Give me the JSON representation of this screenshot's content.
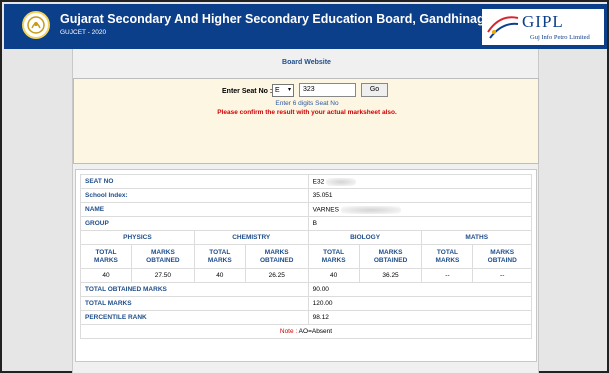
{
  "header": {
    "title": "Gujarat Secondary And Higher Secondary Education Board, Gandhinagar",
    "subtitle": "GUJCET - 2020",
    "brand_name": "GIPL",
    "brand_tagline": "Guj Info Petro Limited",
    "brand_color": "#0c3f8a"
  },
  "board_link": "Board Website",
  "seat_form": {
    "label": "Enter Seat No :",
    "select_value": "E",
    "input_value": "323",
    "go_label": "Go",
    "hint": "Enter 6 digits Seat No",
    "warning": "Please confirm the result with your actual marksheet also."
  },
  "student": {
    "seat_no_label": "SEAT NO",
    "seat_no_value": "E32",
    "school_index_label": "School Index:",
    "school_index_value": "35.051",
    "name_label": "NAME",
    "name_value": "VARNES",
    "group_label": "GROUP",
    "group_value": "B"
  },
  "subjects": [
    {
      "name": "PHYSICS",
      "total_label": "TOTAL MARKS",
      "obtained_label": "MARKS OBTAINED",
      "total": "40",
      "obtained": "27.50"
    },
    {
      "name": "CHEMISTRY",
      "total_label": "TOTAL MARKS",
      "obtained_label": "MARKS OBTAINED",
      "total": "40",
      "obtained": "26.25"
    },
    {
      "name": "BIOLOGY",
      "total_label": "TOTAL MARKS",
      "obtained_label": "MARKS OBTAINED",
      "total": "40",
      "obtained": "36.25"
    },
    {
      "name": "MATHS",
      "total_label": "TOTAL MARKS",
      "obtained_label": "MARKS OBTAIND",
      "total": "--",
      "obtained": "--"
    }
  ],
  "summary": {
    "total_obtained_label": "TOTAL OBTAINED MARKS",
    "total_obtained_value": "90.00",
    "total_marks_label": "TOTAL MARKS",
    "total_marks_value": "120.00",
    "percentile_label": "PERCENTILE RANK",
    "percentile_value": "98.12",
    "note_label": "Note :",
    "note_text": "AO=Absent"
  }
}
